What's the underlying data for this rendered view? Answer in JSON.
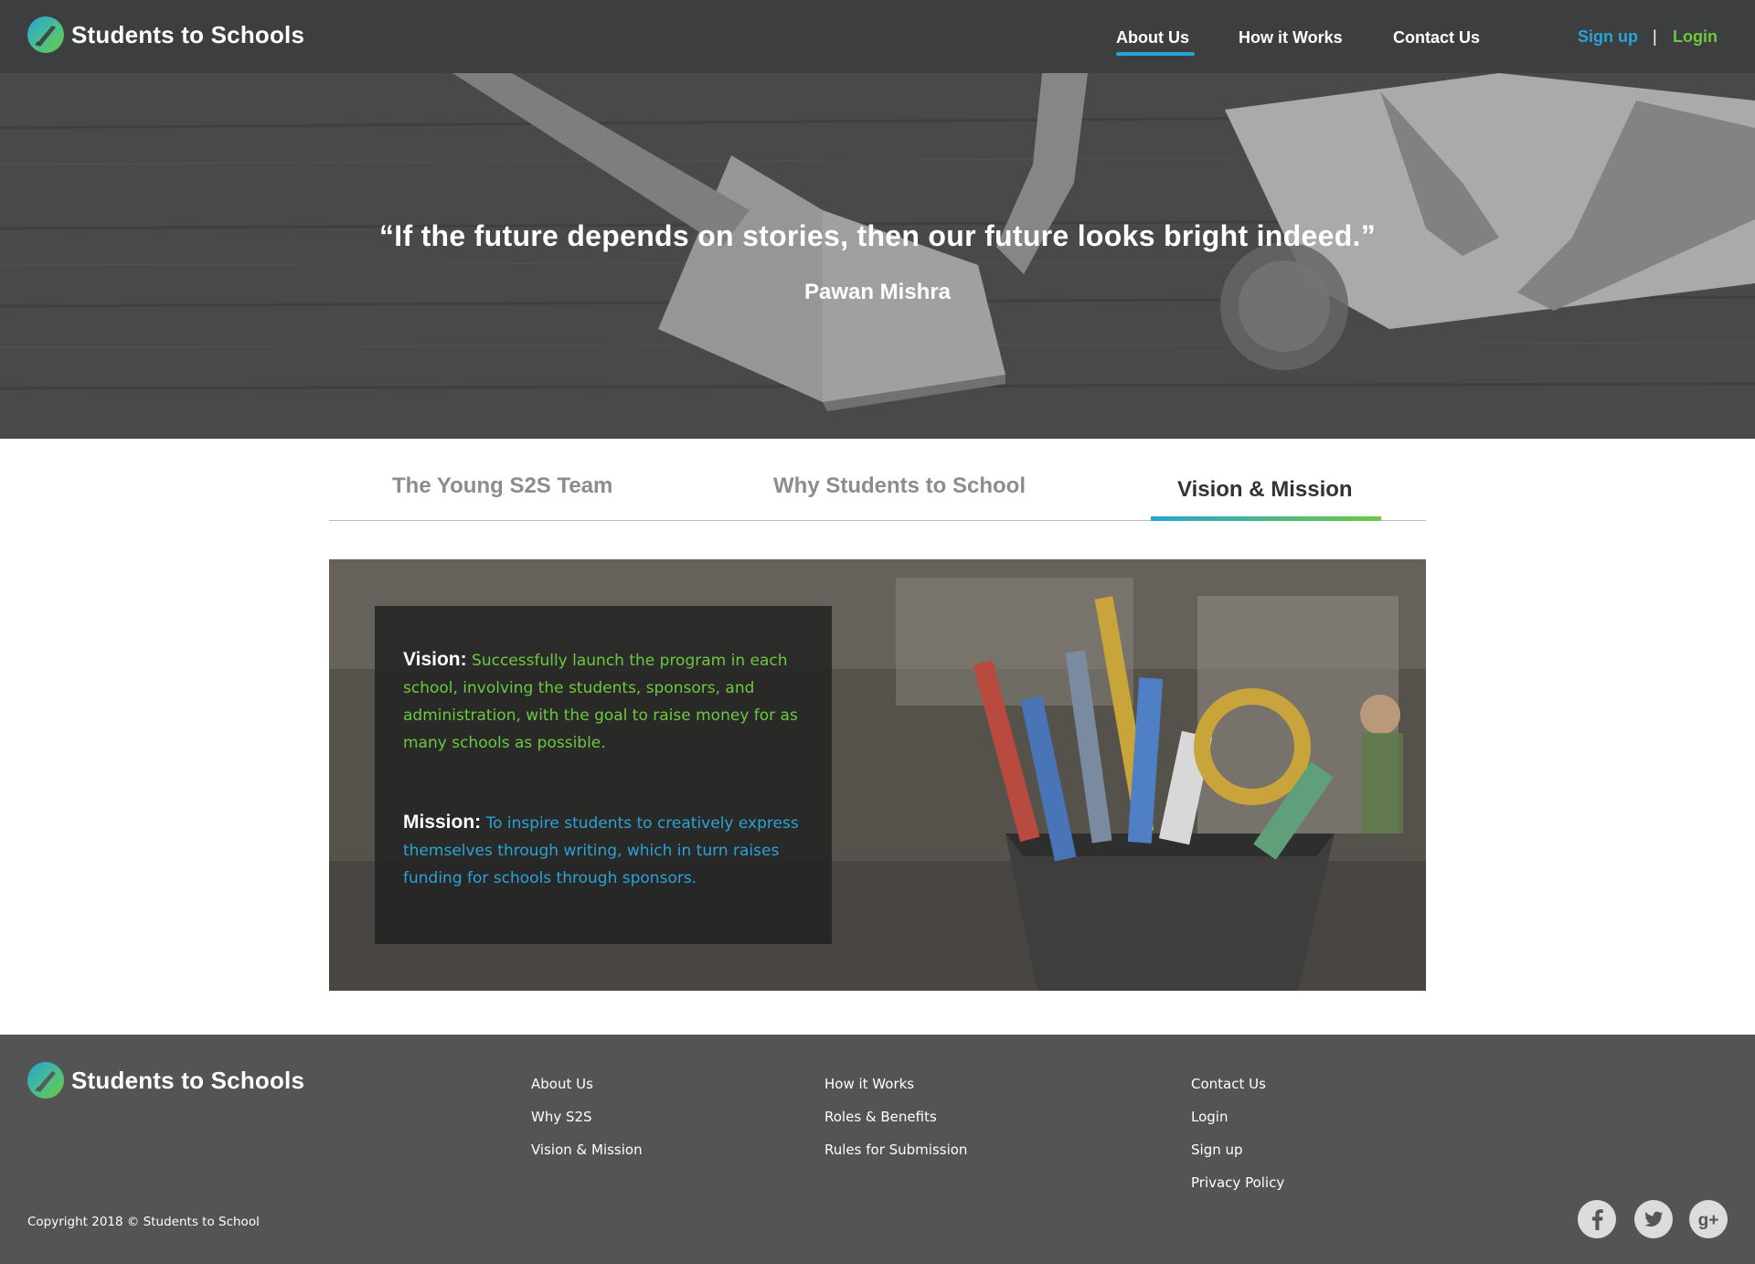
{
  "brand": {
    "name": "Students to Schools"
  },
  "nav": {
    "items": [
      {
        "label": "About Us",
        "active": true
      },
      {
        "label": "How it Works",
        "active": false
      },
      {
        "label": "Contact Us",
        "active": false
      }
    ],
    "signup": "Sign up",
    "separator": "|",
    "login": "Login"
  },
  "hero": {
    "quote": "“If the future depends on stories, then our future looks bright indeed.”",
    "author": "Pawan Mishra"
  },
  "tabs": [
    {
      "label": "The Young S2S Team",
      "active": false
    },
    {
      "label": "Why Students to School",
      "active": false
    },
    {
      "label": "Vision & Mission",
      "active": true
    }
  ],
  "vision_mission": {
    "vision_label": "Vision:",
    "vision_text": "Successfully launch the program in each school, involving the students, sponsors, and administration, with the goal to raise money for as many schools as possible.",
    "mission_label": "Mission:",
    "mission_text": "To inspire students to creatively express themselves through writing, which in turn raises funding for schools through sponsors."
  },
  "footer": {
    "brand": "Students to Schools",
    "col1": [
      "About Us",
      "Why S2S",
      "Vision & Mission"
    ],
    "col2": [
      "How it Works",
      "Roles & Benefits",
      "Rules for Submission"
    ],
    "col3": [
      "Contact Us",
      "Login",
      "Sign up",
      "Privacy Policy"
    ],
    "copyright": "Copyright 2018 ©  Students to School",
    "social": [
      {
        "icon": "facebook-icon",
        "glyph": "f"
      },
      {
        "icon": "twitter-icon",
        "glyph": "t"
      },
      {
        "icon": "google-plus-icon",
        "glyph": "g+"
      }
    ]
  },
  "colors": {
    "header_bg": "#3d3e40",
    "footer_bg": "#545454",
    "accent_blue": "#2aa3d6",
    "accent_green": "#6cc93f"
  }
}
